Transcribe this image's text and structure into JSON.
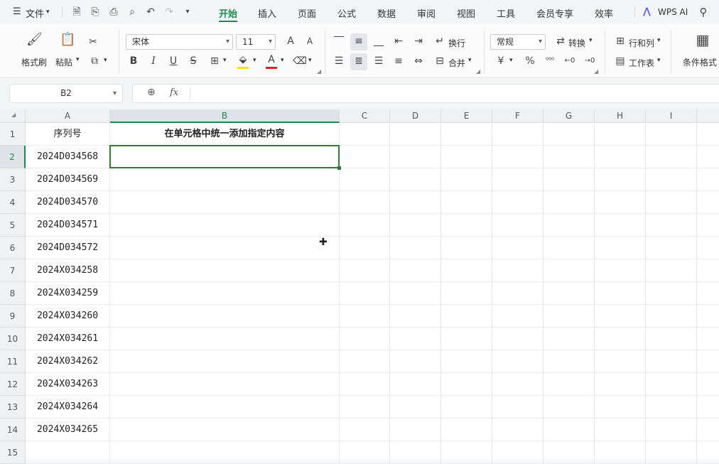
{
  "menu": {
    "main_label": "文件",
    "tabs": [
      {
        "label": "开始",
        "active": true
      },
      {
        "label": "插入"
      },
      {
        "label": "页面"
      },
      {
        "label": "公式"
      },
      {
        "label": "数据"
      },
      {
        "label": "审阅"
      },
      {
        "label": "视图"
      },
      {
        "label": "工具"
      },
      {
        "label": "会员专享"
      },
      {
        "label": "效率"
      }
    ],
    "wps_ai": "WPS AI",
    "accent_color": "#1e8a4f"
  },
  "ribbon": {
    "format_painter": "格式刷",
    "paste": "粘贴",
    "font_name": "宋体",
    "font_size": "11",
    "wrap_text": "换行",
    "merge": "合并",
    "number_format": "常规",
    "convert": "转换",
    "rows_cols": "行和列",
    "worksheet": "工作表",
    "conditional_format": "条件格式",
    "font_glyphs": {
      "bold": "B",
      "italic": "I",
      "underline": "U",
      "strike": "S",
      "grow": "A",
      "shrink": "A",
      "font_color": "A"
    },
    "number_glyphs": {
      "currency": "¥",
      "percent": "%"
    }
  },
  "formula_bar": {
    "name_box": "B2",
    "fx_label": "fx",
    "content": ""
  },
  "sheet": {
    "columns": [
      "A",
      "B",
      "C",
      "D",
      "E",
      "F",
      "G",
      "H",
      "I"
    ],
    "selected_column": "B",
    "selected_row": "2",
    "rows": [
      {
        "num": "1",
        "a": "序列号",
        "b": "在单元格中统一添加指定内容"
      },
      {
        "num": "2",
        "a": "2024D034568",
        "b": ""
      },
      {
        "num": "3",
        "a": "2024D034569",
        "b": ""
      },
      {
        "num": "4",
        "a": "2024D034570",
        "b": ""
      },
      {
        "num": "5",
        "a": "2024D034571",
        "b": ""
      },
      {
        "num": "6",
        "a": "2024D034572",
        "b": ""
      },
      {
        "num": "7",
        "a": "2024X034258",
        "b": ""
      },
      {
        "num": "8",
        "a": "2024X034259",
        "b": ""
      },
      {
        "num": "9",
        "a": "2024X034260",
        "b": ""
      },
      {
        "num": "10",
        "a": "2024X034261",
        "b": ""
      },
      {
        "num": "11",
        "a": "2024X034262",
        "b": ""
      },
      {
        "num": "12",
        "a": "2024X034263",
        "b": ""
      },
      {
        "num": "13",
        "a": "2024X034264",
        "b": ""
      },
      {
        "num": "14",
        "a": "2024X034265",
        "b": ""
      },
      {
        "num": "15",
        "a": "",
        "b": ""
      }
    ]
  }
}
